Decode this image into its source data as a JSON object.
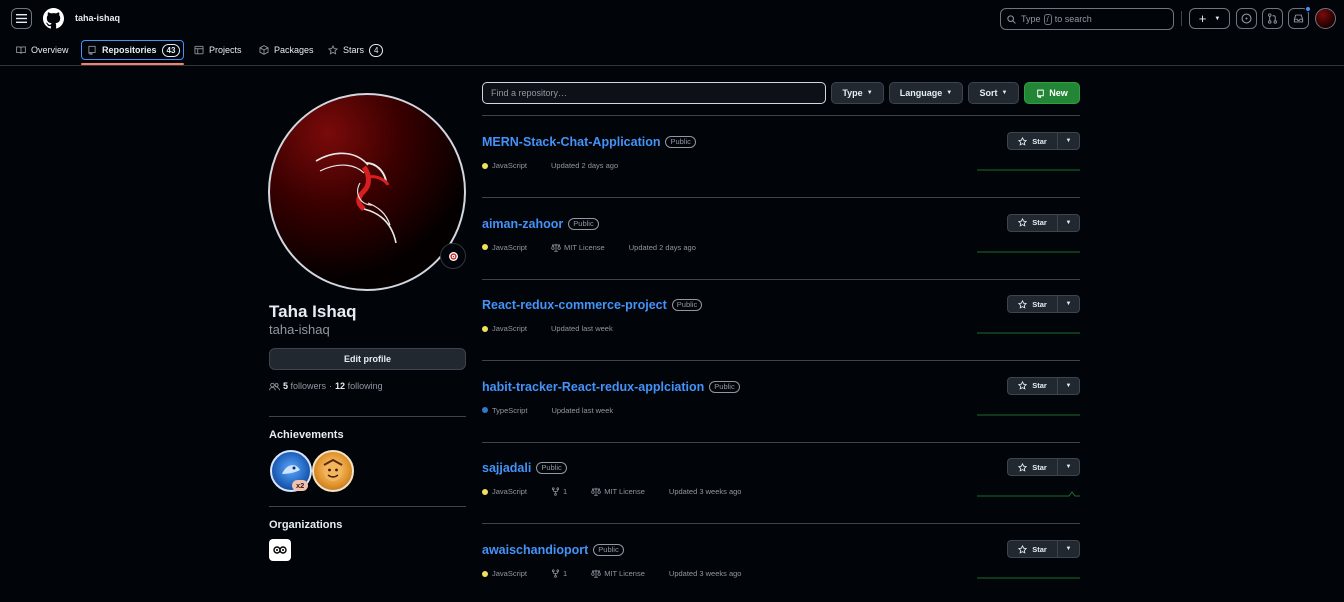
{
  "header": {
    "username": "taha-ishaq",
    "search_prefix": "Type",
    "search_key": "/",
    "search_suffix": "to search",
    "create_label": "+"
  },
  "tabs": [
    {
      "label": "Overview",
      "icon": "book-icon"
    },
    {
      "label": "Repositories",
      "icon": "repo-icon",
      "count": "43"
    },
    {
      "label": "Projects",
      "icon": "table-icon"
    },
    {
      "label": "Packages",
      "icon": "package-icon"
    },
    {
      "label": "Stars",
      "icon": "star-icon",
      "count": "4"
    }
  ],
  "profile": {
    "fullname": "Taha Ishaq",
    "login": "taha-ishaq",
    "edit_label": "Edit profile",
    "followers_count": "5",
    "followers_label": "followers",
    "separator": "·",
    "following_count": "12",
    "following_label": "following",
    "achievements_title": "Achievements",
    "achievement_multiplier": "x2",
    "organizations_title": "Organizations"
  },
  "filters": {
    "find_placeholder": "Find a repository…",
    "type_label": "Type",
    "language_label": "Language",
    "sort_label": "Sort",
    "new_label": "New"
  },
  "star_label": "Star",
  "repos": [
    {
      "name": "MERN-Stack-Chat-Application",
      "visibility": "Public",
      "language": "JavaScript",
      "lang_color": "#f1e05a",
      "updated": "Updated 2 days ago"
    },
    {
      "name": "aiman-zahoor",
      "visibility": "Public",
      "language": "JavaScript",
      "lang_color": "#f1e05a",
      "license": "MIT License",
      "updated": "Updated 2 days ago"
    },
    {
      "name": "React-redux-commerce-project",
      "visibility": "Public",
      "language": "JavaScript",
      "lang_color": "#f1e05a",
      "updated": "Updated last week"
    },
    {
      "name": "habit-tracker-React-redux-applciation",
      "visibility": "Public",
      "language": "TypeScript",
      "lang_color": "#3178c6",
      "updated": "Updated last week"
    },
    {
      "name": "sajjadali",
      "visibility": "Public",
      "language": "JavaScript",
      "lang_color": "#f1e05a",
      "forks": "1",
      "license": "MIT License",
      "updated": "Updated 3 weeks ago"
    },
    {
      "name": "awaischandioport",
      "visibility": "Public",
      "language": "JavaScript",
      "lang_color": "#f1e05a",
      "forks": "1",
      "license": "MIT License",
      "updated": "Updated 3 weeks ago"
    }
  ]
}
